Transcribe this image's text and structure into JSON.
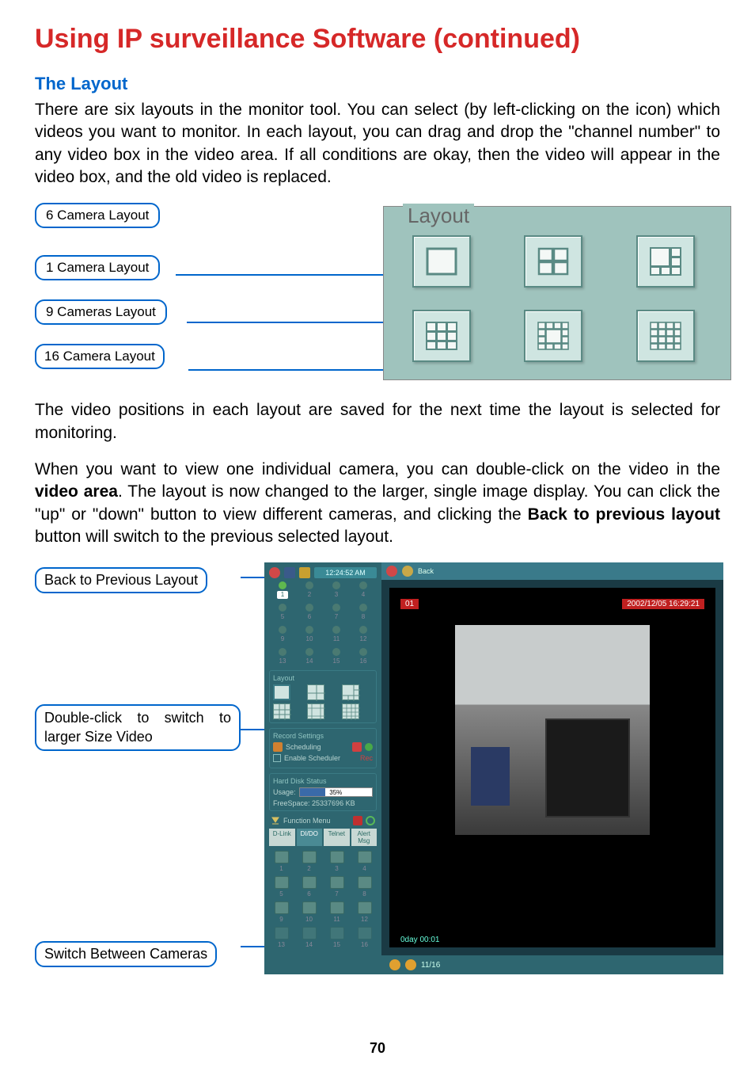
{
  "page": {
    "title": "Using IP surveillance Software (continued)",
    "subtitle": "The Layout",
    "intro": "There are six layouts in the monitor tool. You can select (by left-clicking on the icon) which videos you want to monitor. In each layout, you can drag and drop the \"channel number\" to any video box in the video area. If all conditions are okay, then the video will appear in the video box, and the old video is replaced.",
    "layout_labels": {
      "l6": "6 Camera Layout",
      "l1": "1 Camera Layout",
      "l9": "9 Cameras Layout",
      "l16": "16 Camera Layout"
    },
    "layout_panel_title": "Layout",
    "para2": "The video positions in each layout are saved for the next time the layout is selected for monitoring.",
    "para3_a": "When you want to view one individual camera, you can double-click on the video in the ",
    "para3_bold1": "video area",
    "para3_b": ". The layout is now changed to the larger, single image display. You can click the \"up\" or \"down\" button to view different cameras, and clicking the ",
    "para3_bold2": "Back to previous layout",
    "para3_c": " button will switch to the previous selected layout.",
    "callouts": {
      "back": "Back to Previous Layout",
      "double": "Double-click to switch to larger Size Video",
      "switch": "Switch Between Cameras"
    },
    "page_number": "70"
  },
  "app": {
    "time": "12:24:52 AM",
    "channel": "01",
    "timestamp": "2002/12/05 16:29:21",
    "footer": "0day  00:01",
    "bottom_indicator": "11/16",
    "sections": {
      "layout": "Layout",
      "record": "Record Settings",
      "scheduling": "Scheduling",
      "enable_scheduler": "Enable Scheduler",
      "hard_disk": "Hard Disk Status",
      "usage": "Usage:",
      "usage_pct": "35%",
      "freespace": "FreeSpace: 25337696 KB",
      "function_menu": "Function Menu",
      "rec_flag": "Rec"
    },
    "tabs": [
      "D-Link",
      "DI/DO",
      "Telnet",
      "Alert Msg"
    ]
  }
}
